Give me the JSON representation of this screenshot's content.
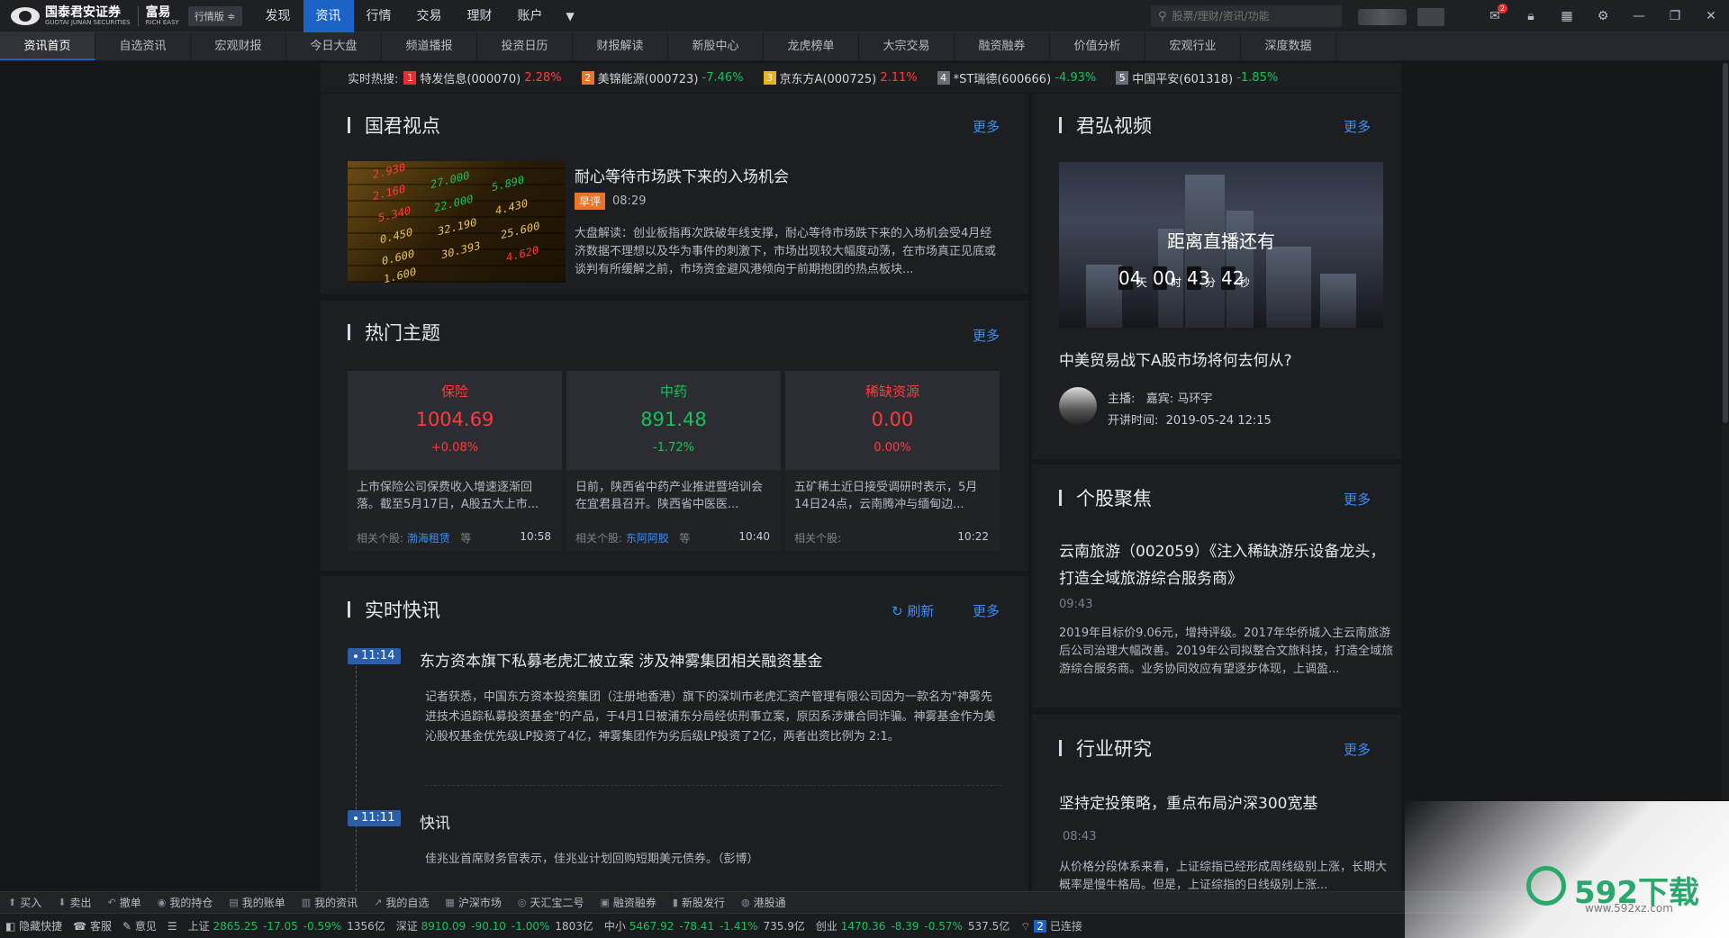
{
  "topbar": {
    "logo_cn": "国泰君安证券",
    "logo_en": "GUOTAI JUNAN SECURITIES",
    "brand2": "富易",
    "brand2_en": "RICH EASY",
    "edition": "行情版",
    "nav": [
      "发现",
      "资讯",
      "行情",
      "交易",
      "理财",
      "账户"
    ],
    "active_nav": "资讯",
    "search_placeholder": "股票/理财/资讯/功能",
    "mail_badge": "2"
  },
  "subnav": {
    "tabs": [
      "资讯首页",
      "自选资讯",
      "宏观财报",
      "今日大盘",
      "频道播报",
      "投资日历",
      "财报解读",
      "新股中心",
      "龙虎榜单",
      "大宗交易",
      "融资融券",
      "价值分析",
      "宏观行业",
      "深度数据"
    ]
  },
  "hot_search": {
    "label": "实时热搜:",
    "items": [
      {
        "rank": "1",
        "name": "特发信息(000070)",
        "change": "2.28%",
        "rank_color": "#e0302f"
      },
      {
        "rank": "2",
        "name": "美锦能源(000723)",
        "change": "-7.46%",
        "rank_color": "#e8762a"
      },
      {
        "rank": "3",
        "name": "京东方A(000725)",
        "change": "2.11%",
        "rank_color": "#e6b422"
      },
      {
        "rank": "4",
        "name": "*ST瑞德(600666)",
        "change": "-4.93%",
        "rank_color": "#6b6e76"
      },
      {
        "rank": "5",
        "name": "中国平安(601318)",
        "change": "-1.85%",
        "rank_color": "#6b6e76"
      }
    ]
  },
  "guojun_view": {
    "title": "国君视点",
    "more": "更多",
    "article_title": "耐心等待市场跌下来的入场机会",
    "tag": "早评",
    "time": "08:29",
    "summary": "大盘解读：创业板指再次跌破年线支撑，耐心等待市场跌下来的入场机会受4月经济数据不理想以及华为事件的刺激下，市场出现较大幅度动荡，在市场真正见底或谈判有所缓解之前，市场资金避风港倾向于前期抱团的热点板块..."
  },
  "hot_themes": {
    "title": "热门主题",
    "more": "更多",
    "cards": [
      {
        "name": "保险",
        "value": "1004.69",
        "change": "+0.08%",
        "dir": "up",
        "desc": "上市保险公司保费收入增速逐渐回落。截至5月17日，A股五大上市...",
        "related_label": "相关个股:",
        "related_stock": "渤海租赁",
        "suffix": "等",
        "time": "10:58"
      },
      {
        "name": "中药",
        "value": "891.48",
        "change": "-1.72%",
        "dir": "down",
        "desc": "日前，陕西省中药产业推进暨培训会在宜君县召开。陕西省中医医...",
        "related_label": "相关个股:",
        "related_stock": "东阿阿胶",
        "suffix": "等",
        "time": "10:40"
      },
      {
        "name": "稀缺资源",
        "value": "0.00",
        "change": "0.00%",
        "dir": "up",
        "desc": "五矿稀土近日接受调研时表示，5月14日24点，云南腾冲与缅甸边...",
        "related_label": "相关个股:",
        "related_stock": "",
        "suffix": "",
        "time": "10:22"
      }
    ]
  },
  "flash_news": {
    "title": "实时快讯",
    "refresh": "刷新",
    "more": "更多",
    "items": [
      {
        "time": "11:14",
        "title": "东方资本旗下私募老虎汇被立案 涉及神雾集团相关融资基金",
        "body": "记者获悉，中国东方资本投资集团（注册地香港）旗下的深圳市老虎汇资产管理有限公司因为一款名为\"神雾先进技术追踪私募投资基金\"的产品，于4月1日被浦东分局经侦刑事立案，原因系涉嫌合同诈骗。神雾基金作为美沁股权基金优先级LP投资了4亿，神雾集团作为劣后级LP投资了2亿，两者出资比例为 2:1。"
      },
      {
        "time": "11:11",
        "title": "快讯",
        "body": "佳兆业首席财务官表示，佳兆业计划回购短期美元债券。（彭博）"
      }
    ]
  },
  "junhong_video": {
    "title": "君弘视频",
    "more": "更多",
    "countdown_label": "距离直播还有",
    "days": "04",
    "hours": "00",
    "minutes": "43",
    "seconds": "42",
    "unit_day": "天",
    "unit_hour": "时",
    "unit_min": "分",
    "unit_sec": "秒",
    "video_title": "中美贸易战下A股市场将何去何从?",
    "host_label": "主播:",
    "guest_label": "嘉宾:",
    "guest": "马环宇",
    "start_label": "开讲时间:",
    "start_time": "2019-05-24 12:15"
  },
  "stock_focus": {
    "title": "个股聚焦",
    "more": "更多",
    "headline": "云南旅游（002059）《注入稀缺游乐设备龙头，打造全域旅游综合服务商》",
    "time": "09:43",
    "body": "2019年目标价9.06元，增持评级。2017年华侨城入主云南旅游后公司治理大幅改善。2019年公司拟整合文旅科技，打造全域旅游综合服务商。业务协同效应有望逐步体现，上调盈..."
  },
  "industry_research": {
    "title": "行业研究",
    "more": "更多",
    "headline": "坚持定投策略，重点布局沪深300宽基",
    "time": "08:43",
    "body": "从价格分段体系来看，上证综指已经形成周线级别上涨，长期大概率是慢牛格局。但是，上证综指的日线级别上涨..."
  },
  "toolbar": {
    "items": [
      "买入",
      "卖出",
      "撤单",
      "我的持仓",
      "我的账单",
      "我的资讯",
      "我的自选",
      "沪深市场",
      "天汇宝二号",
      "融资融券",
      "新股发行",
      "港股通"
    ]
  },
  "statusbar": {
    "hide": "隐藏快捷",
    "service": "客服",
    "feedback": "意见",
    "indices": [
      {
        "name": "上证",
        "value": "2865.25",
        "change": "-17.05",
        "pct": "-0.59%",
        "vol": "1356亿"
      },
      {
        "name": "深证",
        "value": "8910.09",
        "change": "-90.10",
        "pct": "-1.00%",
        "vol": "1803亿"
      },
      {
        "name": "中小",
        "value": "5467.92",
        "change": "-78.41",
        "pct": "-1.41%",
        "vol": "735.9亿"
      },
      {
        "name": "创业",
        "value": "1470.36",
        "change": "-8.39",
        "pct": "-0.57%",
        "vol": "537.5亿"
      }
    ],
    "conn_count": "2",
    "conn_label": "已连接"
  },
  "watermark": {
    "text": "592下载",
    "sub": "www.592xz.com"
  }
}
